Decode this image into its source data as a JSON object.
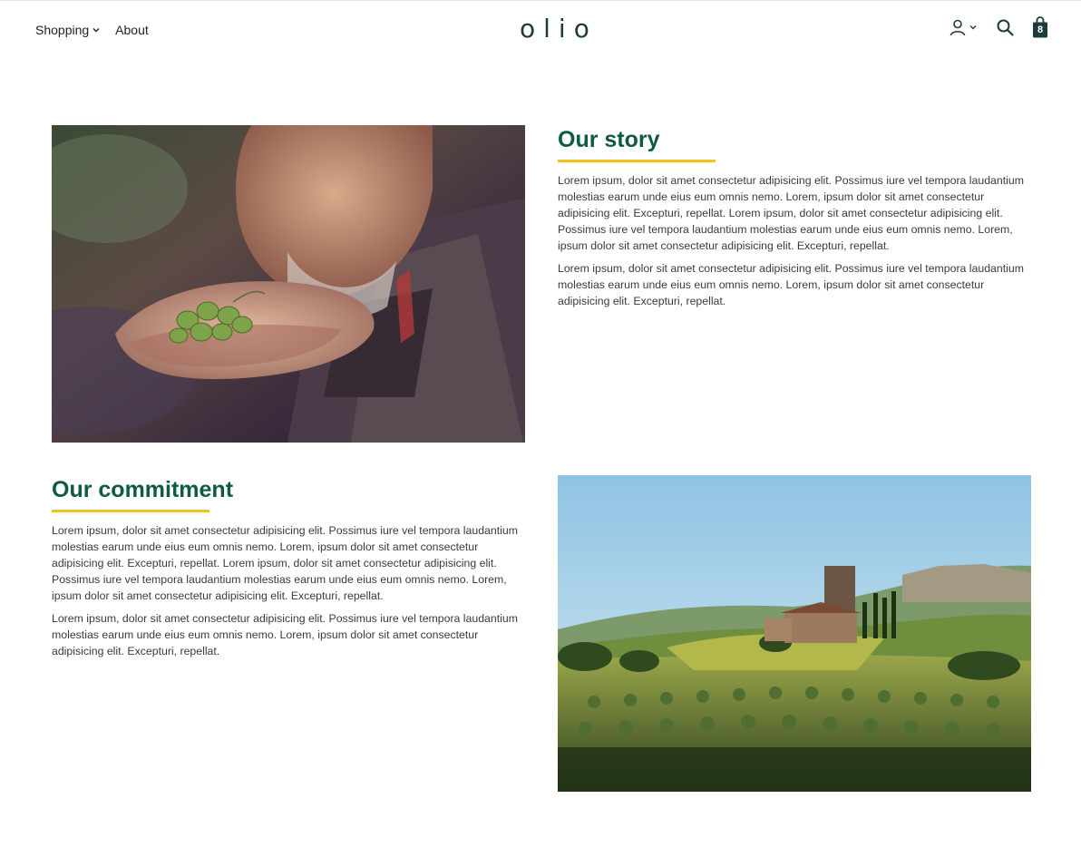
{
  "header": {
    "logo": "olio",
    "nav": [
      {
        "label": "Shopping",
        "has_dropdown": true
      },
      {
        "label": "About",
        "has_dropdown": false
      }
    ],
    "cart_count": "8",
    "icons": [
      "user-icon",
      "chevron-down-icon",
      "search-icon",
      "shopping-bag-icon"
    ]
  },
  "sections": [
    {
      "heading": "Our story",
      "paragraphs": [
        "Lorem ipsum, dolor sit amet consectetur adipisicing elit. Possimus iure vel tempora laudantium molestias earum unde eius eum omnis nemo. Lorem, ipsum dolor sit amet consectetur adipisicing elit. Excepturi, repellat. Lorem ipsum, dolor sit amet consectetur adipisicing elit. Possimus iure vel tempora laudantium molestias earum unde eius eum omnis nemo. Lorem, ipsum dolor sit amet consectetur adipisicing elit. Excepturi, repellat.",
        "Lorem ipsum, dolor sit amet consectetur adipisicing elit. Possimus iure vel tempora laudantium molestias earum unde eius eum omnis nemo. Lorem, ipsum dolor sit amet consectetur adipisicing elit. Excepturi, repellat."
      ]
    },
    {
      "heading": "Our commitment",
      "paragraphs": [
        "Lorem ipsum, dolor sit amet consectetur adipisicing elit. Possimus iure vel tempora laudantium molestias earum unde eius eum omnis nemo. Lorem, ipsum dolor sit amet consectetur adipisicing elit. Excepturi, repellat. Lorem ipsum, dolor sit amet consectetur adipisicing elit. Possimus iure vel tempora laudantium molestias earum unde eius eum omnis nemo. Lorem, ipsum dolor sit amet consectetur adipisicing elit. Excepturi, repellat.",
        "Lorem ipsum, dolor sit amet consectetur adipisicing elit. Possimus iure vel tempora laudantium molestias earum unde eius eum omnis nemo. Lorem, ipsum dolor sit amet consectetur adipisicing elit. Excepturi, repellat."
      ]
    }
  ],
  "colors": {
    "heading": "#0e5c3e",
    "accent_underline": "#f0c419",
    "logo": "#1f3a3d",
    "bag": "#1f3a3d"
  }
}
